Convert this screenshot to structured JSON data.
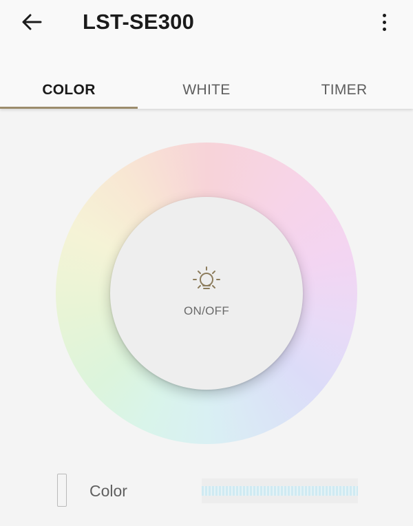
{
  "header": {
    "title": "LST-SE300",
    "back_icon": "arrow-left-icon",
    "more_icon": "more-vertical-icon"
  },
  "tabs": [
    {
      "label": "COLOR",
      "active": true
    },
    {
      "label": "WHITE",
      "active": false
    },
    {
      "label": "TIMER",
      "active": false
    }
  ],
  "control": {
    "power_label": "ON/OFF",
    "power_icon": "bulb-icon"
  },
  "color_row": {
    "label": "Color"
  },
  "colors": {
    "accent": "#9c8c6c",
    "text_primary": "#1b1b1b",
    "text_secondary": "#5e5e5e",
    "background": "#f4f4f4"
  }
}
